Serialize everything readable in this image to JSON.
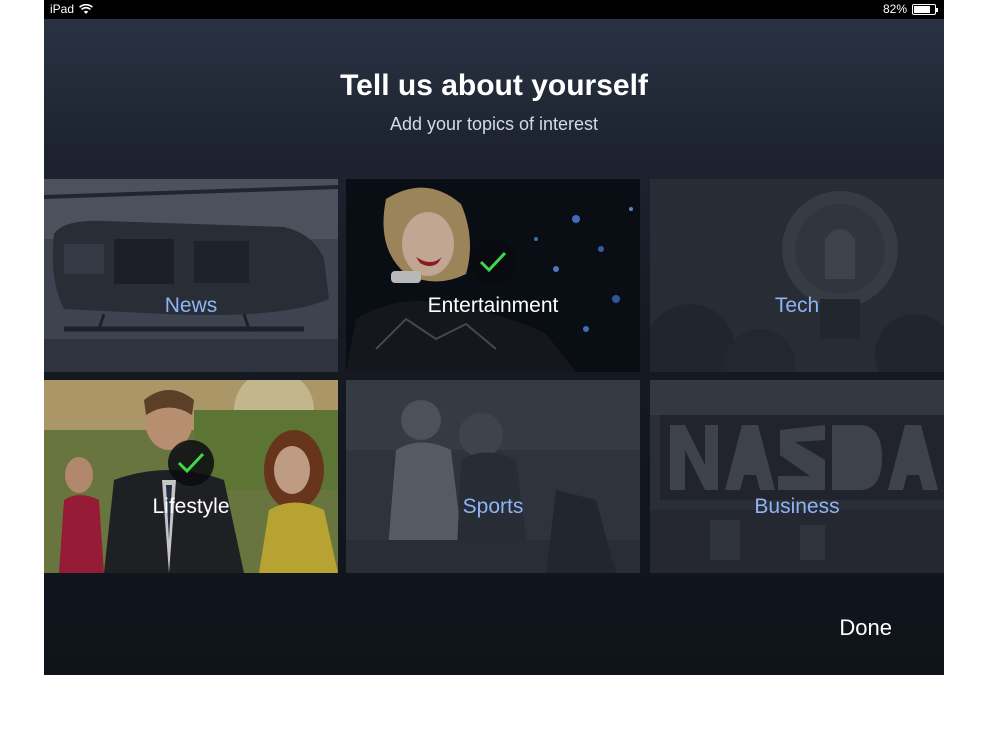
{
  "status_bar": {
    "device": "iPad",
    "battery": "82%",
    "battery_level": 0.82
  },
  "header": {
    "title": "Tell us about yourself",
    "subtitle": "Add your topics of interest"
  },
  "topics": [
    {
      "label": "News",
      "selected": false,
      "image": "helicopter-photo"
    },
    {
      "label": "Entertainment",
      "selected": true,
      "image": "singer-photo"
    },
    {
      "label": "Tech",
      "selected": false,
      "image": "lightbulb-photo"
    },
    {
      "label": "Lifestyle",
      "selected": true,
      "image": "party-photo"
    },
    {
      "label": "Sports",
      "selected": false,
      "image": "football-photo"
    },
    {
      "label": "Business",
      "selected": false,
      "image": "nasdaq-photo"
    }
  ],
  "done_label": "Done",
  "colors": {
    "accent_label": "#8fb4f5",
    "check_green": "#3fd84a"
  }
}
